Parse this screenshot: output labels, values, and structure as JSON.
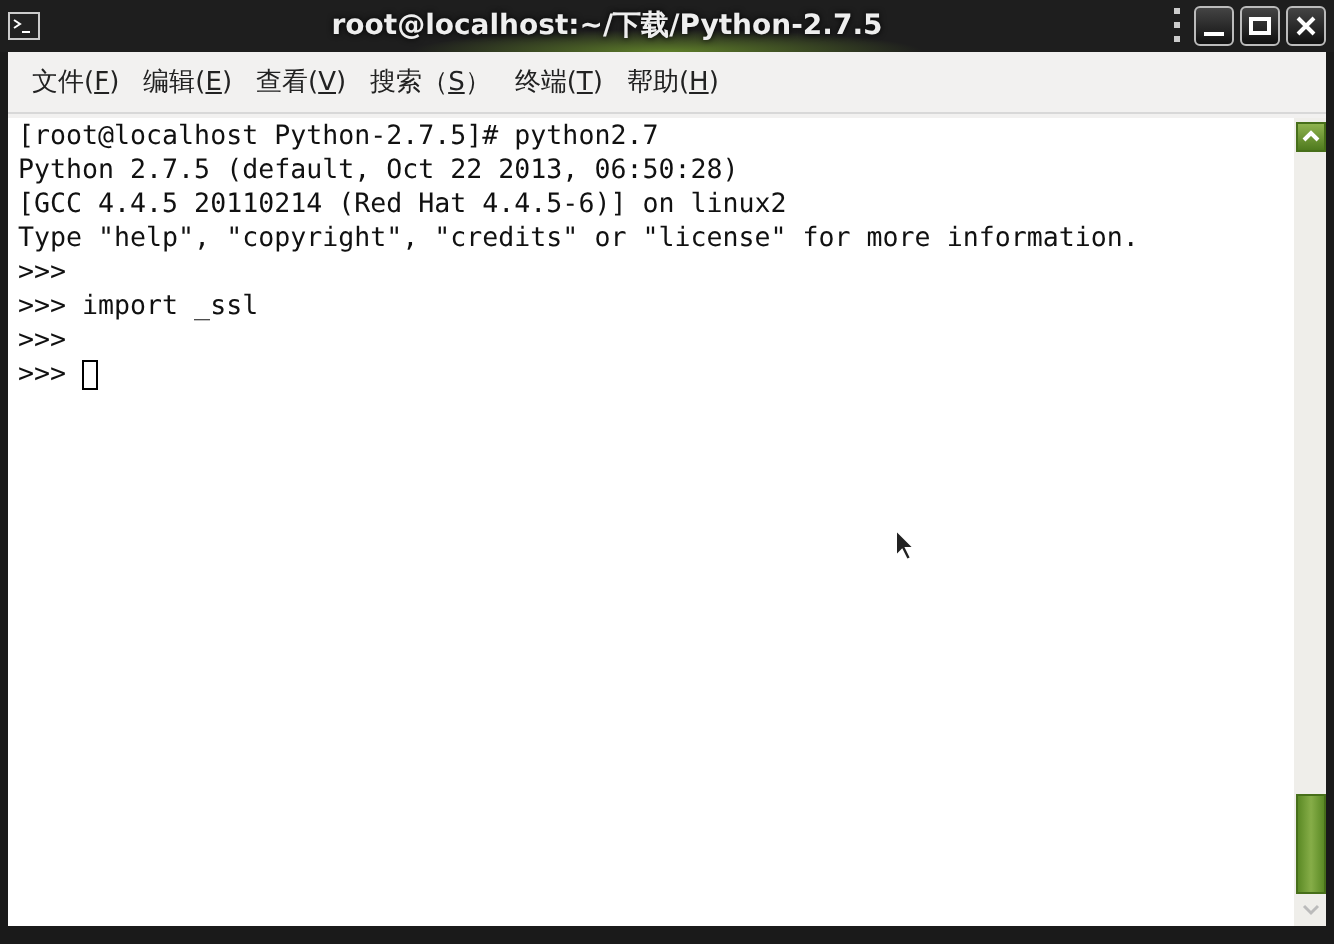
{
  "window": {
    "title": "root@localhost:~/下载/Python-2.7.5"
  },
  "menu": [
    {
      "before": "文件(",
      "key": "F",
      "after": ")"
    },
    {
      "before": "编辑(",
      "key": "E",
      "after": ")"
    },
    {
      "before": "查看(",
      "key": "V",
      "after": ")"
    },
    {
      "before": "搜索（",
      "key": "S",
      "after": "）"
    },
    {
      "before": "终端(",
      "key": "T",
      "after": ")"
    },
    {
      "before": "帮助(",
      "key": "H",
      "after": ")"
    }
  ],
  "terminal": {
    "lines": [
      {
        "text": "[root@localhost Python-2.7.5]# python2.7",
        "cursor": false
      },
      {
        "text": "Python 2.7.5 (default, Oct 22 2013, 06:50:28)",
        "cursor": false
      },
      {
        "text": "[GCC 4.4.5 20110214 (Red Hat 4.4.5-6)] on linux2",
        "cursor": false
      },
      {
        "text": "Type \"help\", \"copyright\", \"credits\" or \"license\" for more information.",
        "cursor": false
      },
      {
        "text": ">>>",
        "cursor": false
      },
      {
        "text": ">>> import _ssl",
        "cursor": false
      },
      {
        "text": ">>>",
        "cursor": false
      },
      {
        "text": ">>> ",
        "cursor": true
      }
    ]
  }
}
